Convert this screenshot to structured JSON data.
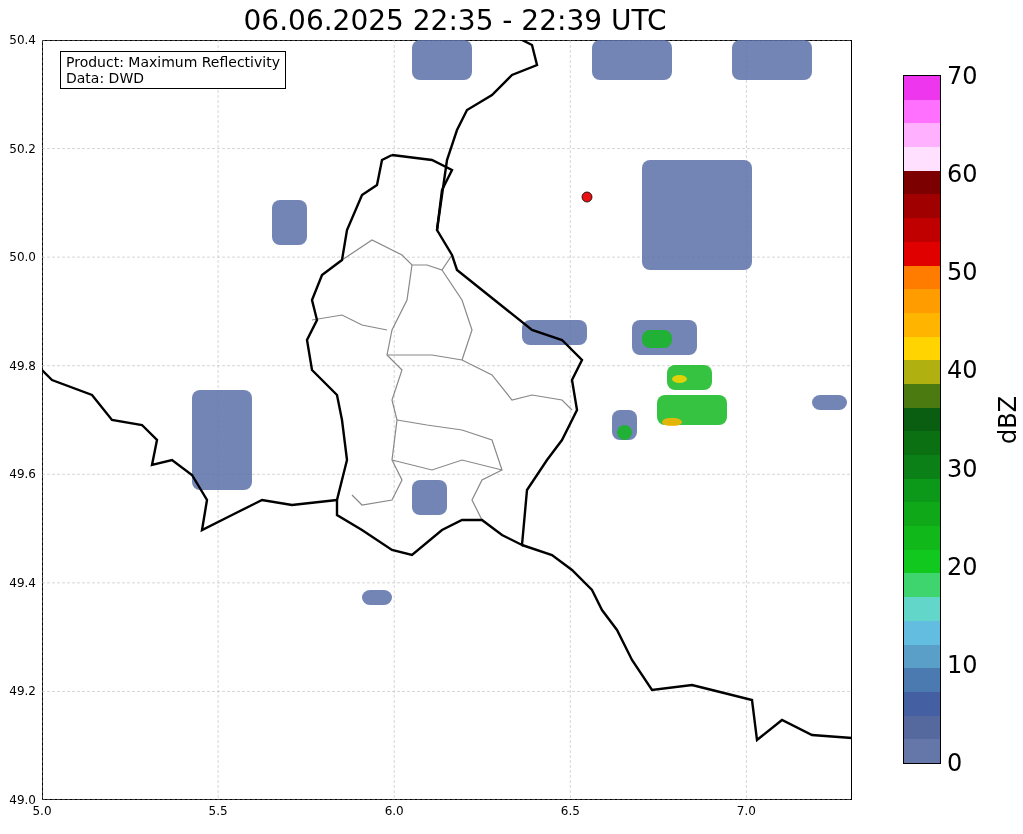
{
  "title": "06.06.2025 22:35 - 22:39 UTC",
  "map": {
    "info_box": [
      "Product: Maximum Reflectivity",
      "Data: DWD"
    ],
    "x_ticks": [
      "5.0",
      "5.5",
      "6.0",
      "6.5",
      "7.0"
    ],
    "y_ticks": [
      "50.4",
      "50.2",
      "50.0",
      "49.8",
      "49.6",
      "49.4",
      "49.2",
      "49.0"
    ]
  },
  "colorbar": {
    "label": "dBZ",
    "ticks": [
      "70",
      "60",
      "50",
      "40",
      "30",
      "20",
      "10",
      "0"
    ],
    "bands": [
      {
        "color": "#6577a8"
      },
      {
        "color": "#56699e"
      },
      {
        "color": "#4560a2"
      },
      {
        "color": "#4a7ab0"
      },
      {
        "color": "#5a9fc8"
      },
      {
        "color": "#62bde0"
      },
      {
        "color": "#62d6c8"
      },
      {
        "color": "#3ed46e"
      },
      {
        "color": "#10c81e"
      },
      {
        "color": "#10b81a"
      },
      {
        "color": "#0ea818"
      },
      {
        "color": "#0c9818"
      },
      {
        "color": "#0b8016"
      },
      {
        "color": "#0a7012"
      },
      {
        "color": "#0a5e12"
      },
      {
        "color": "#4a7a10"
      },
      {
        "color": "#b0b010"
      },
      {
        "color": "#ffd400"
      },
      {
        "color": "#ffb400"
      },
      {
        "color": "#ff9c00"
      },
      {
        "color": "#ff7c00"
      },
      {
        "color": "#e00000"
      },
      {
        "color": "#c00000"
      },
      {
        "color": "#a00000"
      },
      {
        "color": "#7c0000"
      },
      {
        "color": "#ffe0ff"
      },
      {
        "color": "#ffb0ff"
      },
      {
        "color": "#ff70ff"
      },
      {
        "color": "#ee36ee"
      }
    ]
  }
}
